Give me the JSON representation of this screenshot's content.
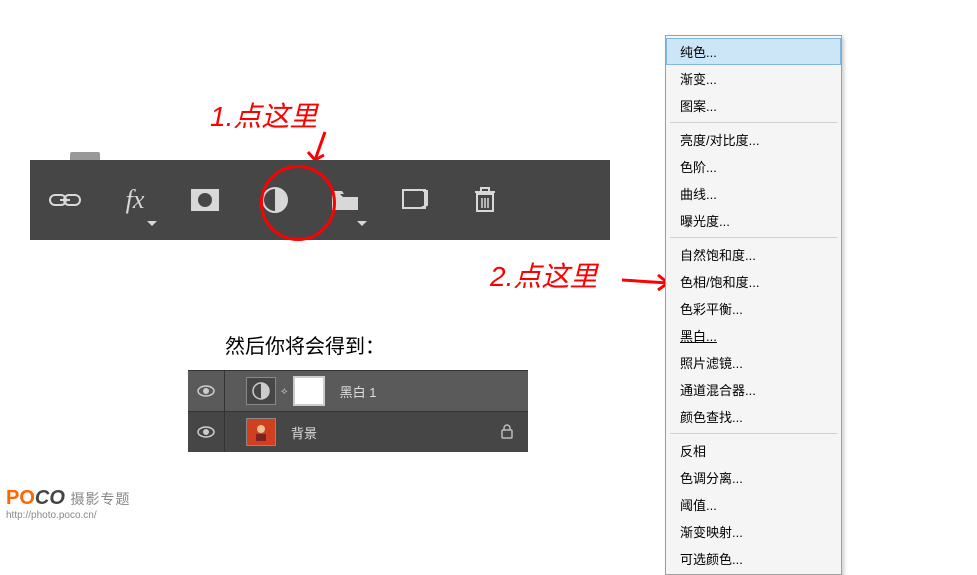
{
  "annotations": {
    "step1": "1.点这里",
    "step2": "2.点这里"
  },
  "instruction_text": "然后你将会得到：",
  "context_menu": {
    "items": [
      "纯色...",
      "渐变...",
      "图案...",
      "亮度/对比度...",
      "色阶...",
      "曲线...",
      "曝光度...",
      "自然饱和度...",
      "色相/饱和度...",
      "色彩平衡...",
      "黑白...",
      "照片滤镜...",
      "通道混合器...",
      "颜色查找...",
      "反相",
      "色调分离...",
      "阈值...",
      "渐变映射...",
      "可选颜色..."
    ],
    "highlighted_index": 10
  },
  "layers": {
    "row1_label": "黑白 1",
    "row2_label": "背景"
  },
  "watermark": {
    "brand1": "PO",
    "brand2": "CO",
    "subtitle": "摄影专题",
    "url": "http://photo.poco.cn/"
  }
}
